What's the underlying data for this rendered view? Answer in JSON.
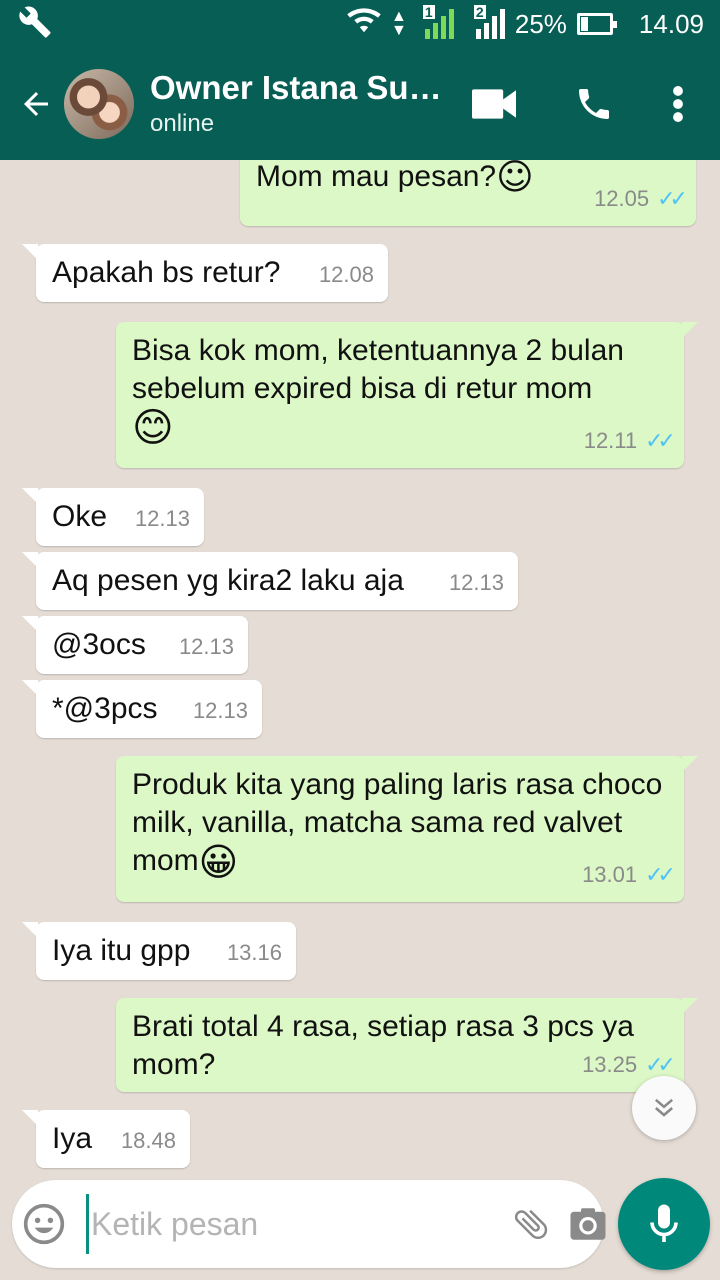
{
  "status_bar": {
    "battery": "25%",
    "time": "14.09",
    "sim1": "1",
    "sim2": "2"
  },
  "header": {
    "contact_name": "Owner Istana Su…",
    "contact_status": "online"
  },
  "messages": [
    {
      "dir": "out",
      "text": "Mom mau pesan?",
      "emoji": "☺",
      "time": "12.05",
      "ticks": "✓✓"
    },
    {
      "dir": "in",
      "text": "Apakah bs retur?",
      "time": "12.08"
    },
    {
      "dir": "out",
      "text": "Bisa kok mom, ketentuannya 2 bulan sebelum expired bisa di retur mom",
      "emoji": "😊",
      "time": "12.11",
      "ticks": "✓✓"
    },
    {
      "dir": "in",
      "text": "Oke",
      "time": "12.13"
    },
    {
      "dir": "in",
      "text": "Aq pesen yg kira2 laku aja",
      "time": "12.13"
    },
    {
      "dir": "in",
      "text": "@3ocs",
      "time": "12.13"
    },
    {
      "dir": "in",
      "text": "*@3pcs",
      "time": "12.13"
    },
    {
      "dir": "out",
      "text": "Produk kita yang paling laris rasa choco milk, vanilla, matcha sama red valvet mom",
      "emoji": "😀",
      "time": "13.01",
      "ticks": "✓✓"
    },
    {
      "dir": "in",
      "text": "Iya itu gpp",
      "time": "13.16"
    },
    {
      "dir": "out",
      "text": "Brati total 4 rasa, setiap rasa 3 pcs ya mom?",
      "time": "13.25",
      "ticks": "✓✓"
    },
    {
      "dir": "in",
      "text": "Iya",
      "time": "18.48"
    }
  ],
  "input": {
    "placeholder": "Ketik pesan"
  },
  "colors": {
    "header": "#075e54",
    "outgoing_bubble": "#dcf8c6",
    "incoming_bubble": "#ffffff",
    "chat_background": "#e5ddd5",
    "read_ticks": "#4fc3f7",
    "mic_button": "#00897b"
  },
  "icons": {
    "status_bar": [
      "wrench-icon",
      "wifi-icon",
      "signal-icon",
      "battery-icon"
    ],
    "header": [
      "back-arrow-icon",
      "video-call-icon",
      "phone-icon",
      "more-vert-icon"
    ],
    "input": [
      "emoji-icon",
      "attach-icon",
      "camera-icon",
      "mic-icon"
    ],
    "chat": [
      "scroll-down-icon"
    ]
  }
}
